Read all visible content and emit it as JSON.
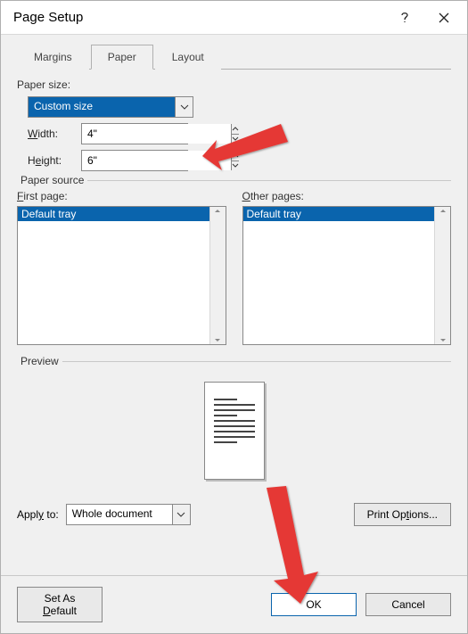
{
  "title": "Page Setup",
  "tabs": {
    "margins": "Margins",
    "paper": "Paper",
    "layout": "Layout"
  },
  "labels": {
    "paper_size": "Paper size:",
    "width": "Width:",
    "height": "Height:",
    "paper_source": "Paper source",
    "first_page": "First page:",
    "other_pages": "Other pages:",
    "preview": "Preview",
    "apply_to": "Apply to:"
  },
  "paper_size_value": "Custom size",
  "width_value": "4\"",
  "height_value": "6\"",
  "first_page_item": "Default tray",
  "other_pages_item": "Default tray",
  "apply_to_value": "Whole document",
  "buttons": {
    "print_options": "Print Options...",
    "set_default": "Set As Default",
    "ok": "OK",
    "cancel": "Cancel"
  }
}
